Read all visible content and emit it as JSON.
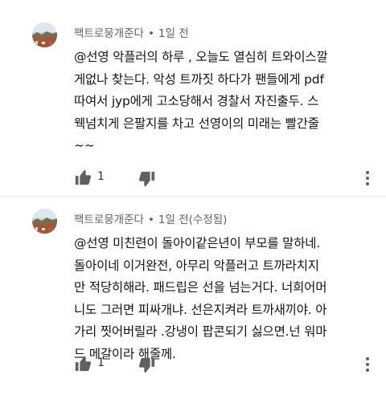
{
  "comments": [
    {
      "author": "팩트로뭉개준다",
      "separator": "•",
      "time": "1일 전",
      "lines": [
        "@선영 악플러의 하루 , 오늘도 열심히 트와이스깔",
        "게없나 찾는다. 악성 트까짓 하다가 팬들에게 pdf",
        "따여서 jyp에게 고소당해서 경찰서 자진출두. 스",
        "웩넘치게 은팔지를 차고 선영이의 미래는 빨간줄",
        "~~"
      ],
      "likes": "1"
    },
    {
      "author": "팩트로뭉개준다",
      "separator": "•",
      "time": "1일 전(수정됨)",
      "lines": [
        "@선영 미친련이 돌아이같은년이 부모를 말하네.",
        "돌아이네 이거완전, 아무리 악플러고 트까라치지",
        "만 적당히해라. 패드립은 선을 넘는거다. 너희어머",
        "니도 그러면 피싸개냐. 선은지켜라 트까새끼야. 아",
        "가리 찟어버릴라 .강냉이 팝콘되기 싫으면.넌 워마",
        "드 메갈이라 해줄께."
      ],
      "likes": "1"
    }
  ],
  "icons": {
    "like": "thumbs-up-icon",
    "dislike": "thumbs-down-icon",
    "more": "more-vertical-icon"
  },
  "colors": {
    "text": "#131313",
    "meta": "#606060",
    "icon": "#606060"
  }
}
